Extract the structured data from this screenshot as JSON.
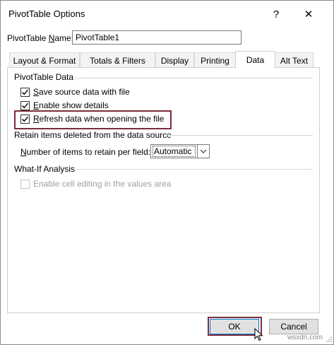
{
  "window": {
    "title": "PivotTable Options",
    "help_glyph": "?",
    "close_glyph": "✕",
    "help_icon": "question-icon",
    "close_icon": "close-icon"
  },
  "name_field": {
    "label_prefix": "PivotTable ",
    "label_accel": "N",
    "label_suffix": "ame:",
    "value": "PivotTable1"
  },
  "tabs": [
    {
      "label": "Layout & Format",
      "active": false
    },
    {
      "label": "Totals & Filters",
      "active": false
    },
    {
      "label": "Display",
      "active": false
    },
    {
      "label": "Printing",
      "active": false
    },
    {
      "label": "Data",
      "active": true
    },
    {
      "label": "Alt Text",
      "active": false
    }
  ],
  "data_section": {
    "title": "PivotTable Data",
    "options": [
      {
        "accel": "S",
        "rest": "ave source data with file",
        "checked": true
      },
      {
        "accel": "E",
        "rest": "nable show details",
        "checked": true
      },
      {
        "accel": "R",
        "rest": "efresh data when opening the file",
        "checked": true
      }
    ]
  },
  "retain_section": {
    "title": "Retain items deleted from the data source",
    "label_accel": "N",
    "label_rest": "umber of items to retain per field:",
    "selected": "Automatic"
  },
  "whatif_section": {
    "title": "What-If Analysis",
    "option_label": "Enable cell editing in the values area",
    "option_checked": false,
    "option_enabled": false
  },
  "buttons": {
    "ok": "OK",
    "cancel": "Cancel"
  },
  "watermark": "wsxdn.com",
  "colors": {
    "highlight": "#7b2d3b",
    "focus_blue": "#0078d7"
  }
}
